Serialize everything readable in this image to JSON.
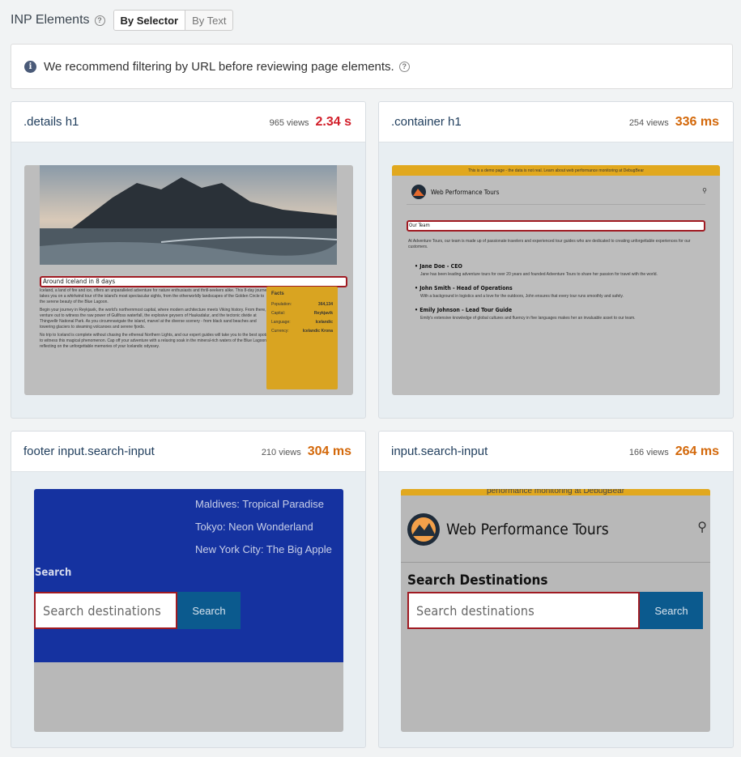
{
  "header": {
    "title": "INP Elements",
    "tabs": [
      {
        "label": "By Selector"
      },
      {
        "label": "By Text"
      }
    ]
  },
  "notice": {
    "text": "We recommend filtering by URL before reviewing page elements."
  },
  "cards": [
    {
      "selector": ".details h1",
      "views": "965 views",
      "time": "2.34 s",
      "preview": {
        "heading": "Around Iceland in 8 days",
        "para1": "Iceland, a land of fire and ice, offers an unparalleled adventure for nature enthusiasts and thrill-seekers alike. This 8-day journey takes you on a whirlwind tour of the island's most spectacular sights, from the otherworldly landscapes of the Golden Circle to the serene beauty of the Blue Lagoon.",
        "para2": "Begin your journey in Reykjavik, the world's northernmost capital, where modern architecture meets Viking history. From there, venture out to witness the raw power of Gullfoss waterfall, the explosive geysers of Haukadalur, and the tectonic divide at Thingvellir National Park. As you circumnavigate the island, marvel at the diverse scenery - from black sand beaches and towering glaciers to steaming volcanoes and serene fjords.",
        "para3": "No trip to Iceland is complete without chasing the ethereal Northern Lights, and our expert guides will take you to the best spots to witness this magical phenomenon. Cap off your adventure with a relaxing soak in the mineral-rich waters of the Blue Lagoon, reflecting on the unforgettable memories of your Icelandic odyssey.",
        "facts_title": "Facts",
        "facts": [
          {
            "k": "Population:",
            "v": "364,134"
          },
          {
            "k": "Capital:",
            "v": "Reykjavik"
          },
          {
            "k": "Language:",
            "v": "Icelandic"
          },
          {
            "k": "Currency:",
            "v": "Icelandic Krona"
          }
        ]
      }
    },
    {
      "selector": ".container h1",
      "views": "254 views",
      "time": "336 ms",
      "preview": {
        "banner": "This is a demo page - the data is not real. Learn about web performance monitoring at DebugBear",
        "brand": "Web Performance Tours",
        "heading": "Our Team",
        "intro": "At Adventure Tours, our team is made up of passionate travelers and experienced tour guides who are dedicated to creating unforgettable experiences for our customers.",
        "members": [
          {
            "name": "Jane Doe - CEO",
            "bio": "Jane has been leading adventure tours for over 20 years and founded Adventure Tours to share her passion for travel with the world."
          },
          {
            "name": "John Smith - Head of Operations",
            "bio": "With a background in logistics and a love for the outdoors, John ensures that every tour runs smoothly and safely."
          },
          {
            "name": "Emily Johnson - Lead Tour Guide",
            "bio": "Emily's extensive knowledge of global cultures and fluency in five languages makes her an invaluable asset to our team."
          }
        ]
      }
    },
    {
      "selector": "footer input.search-input",
      "views": "210 views",
      "time": "304 ms",
      "preview": {
        "links": [
          "Maldives: Tropical Paradise",
          "Tokyo: Neon Wonderland",
          "New York City: The Big Apple"
        ],
        "search_label": "Search",
        "placeholder": "Search destinations",
        "button": "Search"
      }
    },
    {
      "selector": "input.search-input",
      "views": "166 views",
      "time": "264 ms",
      "preview": {
        "banner": "performance monitoring at DebugBear",
        "brand": "Web Performance Tours",
        "heading": "Search Destinations",
        "placeholder": "Search destinations",
        "button": "Search"
      }
    }
  ],
  "colors": {
    "accent_red": "#d21f2a",
    "accent_orange": "#d3680a",
    "link": "#1f3d5c",
    "search_bg": "#1532a0",
    "banner": "#e1a81e"
  }
}
